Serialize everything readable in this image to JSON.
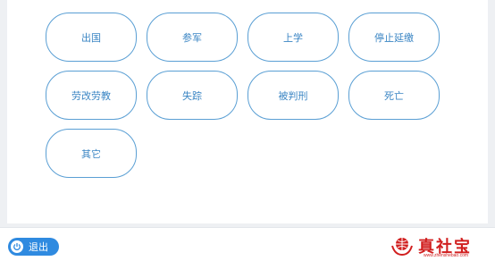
{
  "options": [
    {
      "label": "出国"
    },
    {
      "label": "参军"
    },
    {
      "label": "上学"
    },
    {
      "label": "停止延缴"
    },
    {
      "label": "劳改劳教"
    },
    {
      "label": "失踪"
    },
    {
      "label": "被判刑"
    },
    {
      "label": "死亡"
    },
    {
      "label": "其它"
    }
  ],
  "footer": {
    "exit_label": "退出",
    "exit_icon": "power-icon"
  },
  "watermark": {
    "name": "真社宝",
    "url": "www.zhenshebao.com",
    "icon": "globe-hands-icon",
    "color": "#d11f1f"
  },
  "colors": {
    "accent": "#3b86c4",
    "button": "#2f8ae0"
  }
}
